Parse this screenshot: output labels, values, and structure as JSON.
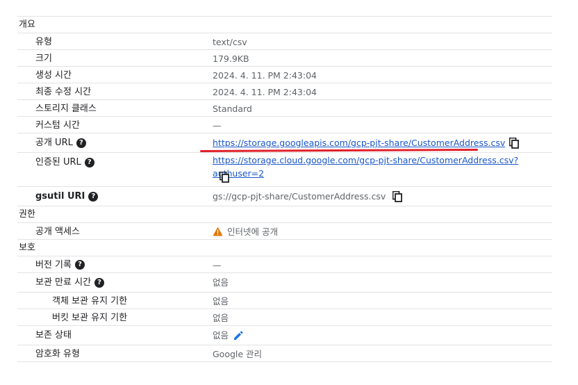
{
  "sections": {
    "overview": "개요",
    "permissions": "권한",
    "protection": "보호"
  },
  "overview": {
    "type_label": "유형",
    "type_value": "text/csv",
    "size_label": "크기",
    "size_value": "179.9KB",
    "created_label": "생성 시간",
    "created_value": "2024. 4. 11. PM 2:43:04",
    "modified_label": "최종 수정 시간",
    "modified_value": "2024. 4. 11. PM 2:43:04",
    "storage_class_label": "스토리지 클래스",
    "storage_class_value": "Standard",
    "custom_time_label": "커스텀 시간",
    "custom_time_value": "—",
    "public_url_label": "공개 URL",
    "public_url_value": "https://storage.googleapis.com/gcp-pjt-share/CustomerAddress.csv",
    "auth_url_label": "인증된 URL",
    "auth_url_value": "https://storage.cloud.google.com/gcp-pjt-share/CustomerAddress.csv?authuser=2",
    "gsutil_label": "gsutil URI",
    "gsutil_value": "gs://gcp-pjt-share/CustomerAddress.csv"
  },
  "permissions": {
    "public_access_label": "공개 액세스",
    "public_access_value": "인터넷에 공개"
  },
  "protection": {
    "version_history_label": "버전 기록",
    "version_history_value": "—",
    "retention_label": "보관 만료 시간",
    "retention_value": "없음",
    "object_retention_label": "객체 보관 유지 기한",
    "object_retention_value": "없음",
    "bucket_retention_label": "버킷 보관 유지 기한",
    "bucket_retention_value": "없음",
    "hold_label": "보존 상태",
    "hold_value": "없음",
    "encryption_label": "암호화 유형",
    "encryption_value": "Google 관리"
  },
  "icons": {
    "help": "?",
    "help_name": "help-circle-icon",
    "copy_name": "copy-icon",
    "edit_name": "pencil-icon",
    "warning_name": "warning-triangle-icon"
  },
  "colors": {
    "link": "#1a57c8",
    "warning": "#e37400",
    "edit": "#1a73e8",
    "annotation": "#e0202a"
  }
}
